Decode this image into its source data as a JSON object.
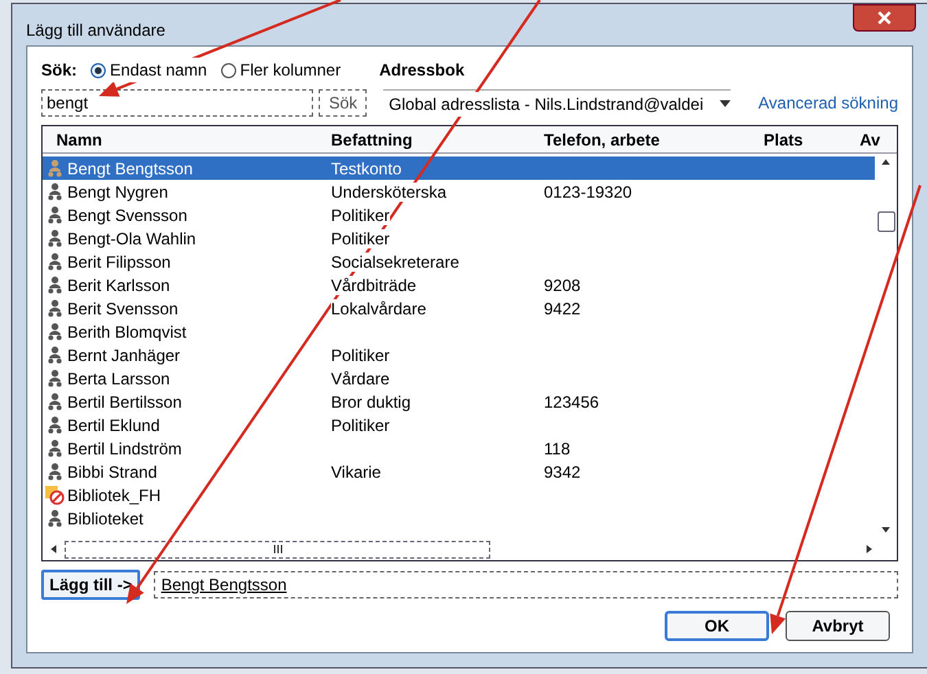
{
  "window": {
    "title": "Lägg till användare"
  },
  "search": {
    "label": "Sök:",
    "options": [
      {
        "label": "Endast namn",
        "selected": true
      },
      {
        "label": "Fler kolumner",
        "selected": false
      }
    ],
    "value": "bengt",
    "button": "Sök"
  },
  "address_book": {
    "label": "Adressbok",
    "value": "Global adresslista - Nils.Lindstrand@valdei"
  },
  "advanced_link": "Avancerad sökning",
  "table": {
    "columns": [
      "Namn",
      "Befattning",
      "Telefon, arbete",
      "Plats",
      "Av"
    ],
    "rows": [
      {
        "kind": "person",
        "name": "Bengt Bengtsson",
        "title": "Testkonto",
        "selected": true
      },
      {
        "kind": "person",
        "name": "Bengt Nygren",
        "title": "Undersköterska",
        "phone": "0123-19320",
        "selected": false
      },
      {
        "kind": "person",
        "name": "Bengt Svensson",
        "title": "Politiker",
        "selected": false
      },
      {
        "kind": "person",
        "name": "Bengt-Ola Wahlin",
        "title": "Politiker",
        "selected": false
      },
      {
        "kind": "person",
        "name": "Berit Filipsson",
        "title": "Socialsekreterare",
        "selected": false
      },
      {
        "kind": "person",
        "name": "Berit Karlsson",
        "title": "Vårdbiträde",
        "phone": "9208",
        "selected": false
      },
      {
        "kind": "person",
        "name": "Berit Svensson",
        "title": "Lokalvårdare",
        "phone": "9422",
        "selected": false
      },
      {
        "kind": "person",
        "name": "Berith Blomqvist",
        "selected": false
      },
      {
        "kind": "person",
        "name": "Bernt Janhäger",
        "title": "Politiker",
        "selected": false
      },
      {
        "kind": "person",
        "name": "Berta Larsson",
        "title": "Vårdare",
        "selected": false
      },
      {
        "kind": "person",
        "name": "Bertil Bertilsson",
        "title": "Bror duktig",
        "phone": "123456",
        "selected": false
      },
      {
        "kind": "person",
        "name": "Bertil Eklund",
        "title": "Politiker",
        "selected": false
      },
      {
        "kind": "person",
        "name": "Bertil Lindström",
        "phone": "118",
        "selected": false
      },
      {
        "kind": "person",
        "name": "Bibbi Strand",
        "title": "Vikarie",
        "phone": "9342",
        "selected": false
      },
      {
        "kind": "resource",
        "name": "Bibliotek_FH",
        "selected": false
      },
      {
        "kind": "person",
        "name": "Biblioteket",
        "selected": false
      }
    ]
  },
  "add_button": "Lägg till ->",
  "added": "Bengt Bengtsson",
  "buttons": [
    {
      "label": "OK",
      "kind": "default"
    },
    {
      "label": "Avbryt",
      "kind": "normal"
    }
  ]
}
